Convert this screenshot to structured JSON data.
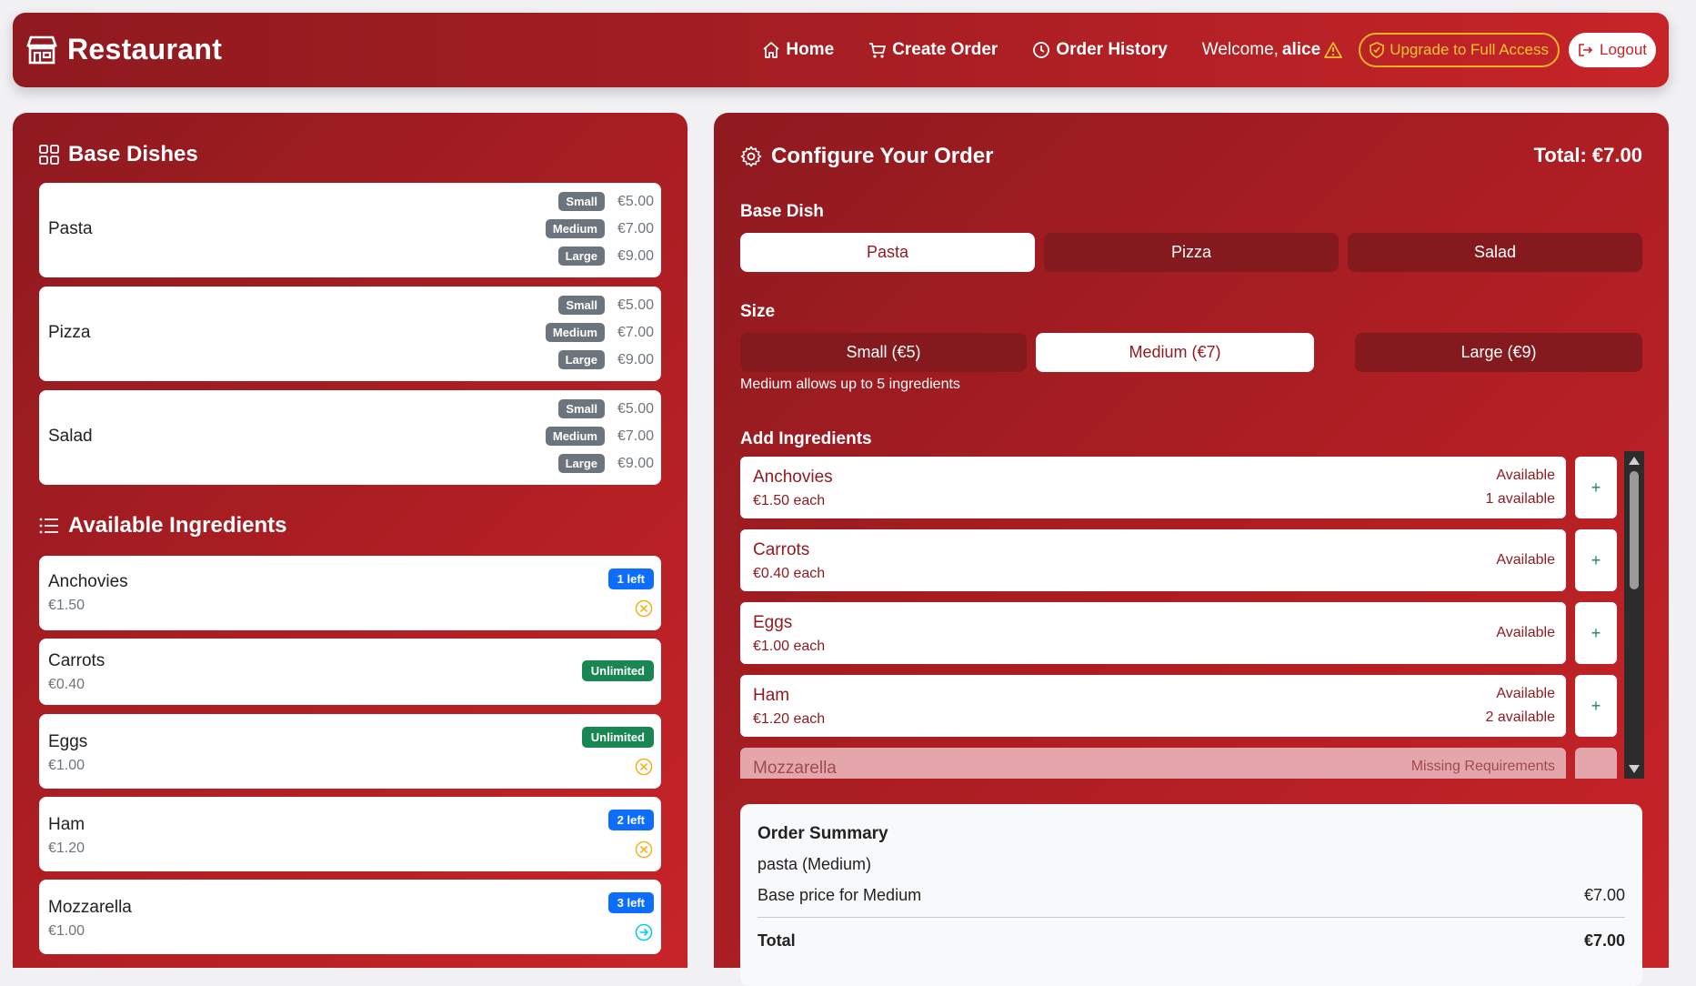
{
  "navbar": {
    "brand": "Restaurant",
    "links": [
      {
        "label": "Home",
        "icon": "home-icon"
      },
      {
        "label": "Create Order",
        "icon": "cart-icon"
      },
      {
        "label": "Order History",
        "icon": "clock-icon"
      }
    ],
    "welcome_prefix": "Welcome,",
    "username": "alice",
    "upgrade_label": "Upgrade to Full Access",
    "logout_label": "Logout"
  },
  "base_dishes": {
    "title": "Base Dishes",
    "items": [
      {
        "name": "Pasta",
        "prices": [
          {
            "size": "Small",
            "price": "€5.00"
          },
          {
            "size": "Medium",
            "price": "€7.00"
          },
          {
            "size": "Large",
            "price": "€9.00"
          }
        ]
      },
      {
        "name": "Pizza",
        "prices": [
          {
            "size": "Small",
            "price": "€5.00"
          },
          {
            "size": "Medium",
            "price": "€7.00"
          },
          {
            "size": "Large",
            "price": "€9.00"
          }
        ]
      },
      {
        "name": "Salad",
        "prices": [
          {
            "size": "Small",
            "price": "€5.00"
          },
          {
            "size": "Medium",
            "price": "€7.00"
          },
          {
            "size": "Large",
            "price": "€9.00"
          }
        ]
      }
    ]
  },
  "available_ingredients": {
    "title": "Available Ingredients",
    "items": [
      {
        "name": "Anchovies",
        "price": "€1.50",
        "stock": "1 left"
      },
      {
        "name": "Carrots",
        "price": "€0.40",
        "stock": "Unlimited"
      },
      {
        "name": "Eggs",
        "price": "€1.00",
        "stock": "Unlimited"
      },
      {
        "name": "Ham",
        "price": "€1.20",
        "stock": "2 left"
      },
      {
        "name": "Mozzarella",
        "price": "€1.00",
        "stock": "3 left"
      }
    ]
  },
  "configure": {
    "title": "Configure Your Order",
    "total": "Total: €7.00",
    "base_dish_label": "Base Dish",
    "base_dish_options": [
      "Pasta",
      "Pizza",
      "Salad"
    ],
    "selected_base": "Pasta",
    "size_label": "Size",
    "size_options": [
      "Small (€5)",
      "Medium (€7)",
      "Large (€9)"
    ],
    "selected_size": "Medium (€7)",
    "size_hint": "Medium allows up to 5 ingredients",
    "ingredients_label": "Add Ingredients",
    "ingredients": [
      {
        "name": "Anchovies",
        "price": "€1.50 each",
        "status": "Available",
        "count": "1 available"
      },
      {
        "name": "Carrots",
        "price": "€0.40 each",
        "status": "Available",
        "count": ""
      },
      {
        "name": "Eggs",
        "price": "€1.00 each",
        "status": "Available",
        "count": ""
      },
      {
        "name": "Ham",
        "price": "€1.20 each",
        "status": "Available",
        "count": "2 available"
      },
      {
        "name": "Mozzarella",
        "price": "",
        "status": "Missing Requirements",
        "count": ""
      }
    ],
    "add_symbol": "+"
  },
  "summary": {
    "title": "Order Summary",
    "item_line": "pasta (Medium)",
    "base_price_label": "Base price for Medium",
    "base_price_value": "€7.00",
    "total_label": "Total",
    "total_value": "€7.00"
  }
}
